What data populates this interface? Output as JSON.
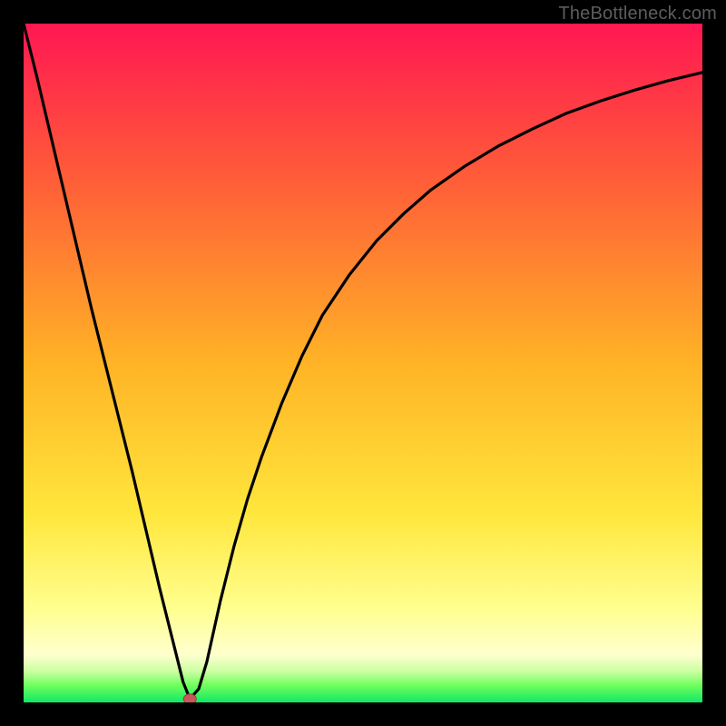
{
  "watermark": "TheBottleneck.com",
  "colors": {
    "frame": "#000000",
    "curve": "#000000",
    "marker_fill": "#c65a5a",
    "marker_stroke": "#9c3a3a",
    "grad_top": "#ff1752",
    "grad_upper": "#ff5a39",
    "grad_mid": "#ffb326",
    "grad_yellow": "#ffe63b",
    "grad_paleyellow": "#ffff8e",
    "grad_lightgreen": "#8eff66",
    "grad_green": "#11e864"
  },
  "chart_data": {
    "type": "line",
    "title": "",
    "xlabel": "",
    "ylabel": "",
    "xlim": [
      0,
      100
    ],
    "ylim": [
      0,
      100
    ],
    "grid": false,
    "legend": false,
    "annotations": [],
    "series": [
      {
        "name": "bottleneck-curve",
        "x": [
          0,
          2,
          4,
          6,
          8,
          10,
          12,
          14,
          16,
          18,
          20,
          22,
          23.5,
          24.5,
          25.8,
          27,
          29,
          31,
          33,
          35,
          38,
          41,
          44,
          48,
          52,
          56,
          60,
          65,
          70,
          75,
          80,
          85,
          90,
          95,
          100
        ],
        "y": [
          100,
          92,
          83.5,
          75,
          66.5,
          58,
          50,
          42,
          34,
          25.5,
          17,
          9,
          3,
          0.5,
          2,
          6,
          15,
          23,
          30,
          36,
          44,
          51,
          57,
          63,
          68,
          72,
          75.5,
          79,
          82,
          84.5,
          86.8,
          88.6,
          90.2,
          91.6,
          92.8
        ]
      }
    ],
    "marker": {
      "x": 24.5,
      "y": 0.5
    },
    "background_gradient_stops": [
      {
        "pos": 0.0,
        "color": "#ff1752"
      },
      {
        "pos": 0.22,
        "color": "#ff5a39"
      },
      {
        "pos": 0.5,
        "color": "#ffb326"
      },
      {
        "pos": 0.72,
        "color": "#ffe63b"
      },
      {
        "pos": 0.86,
        "color": "#ffff8e"
      },
      {
        "pos": 0.93,
        "color": "#ffffce"
      },
      {
        "pos": 0.955,
        "color": "#c8ffa0"
      },
      {
        "pos": 0.975,
        "color": "#6eff5c"
      },
      {
        "pos": 1.0,
        "color": "#11e864"
      }
    ]
  }
}
